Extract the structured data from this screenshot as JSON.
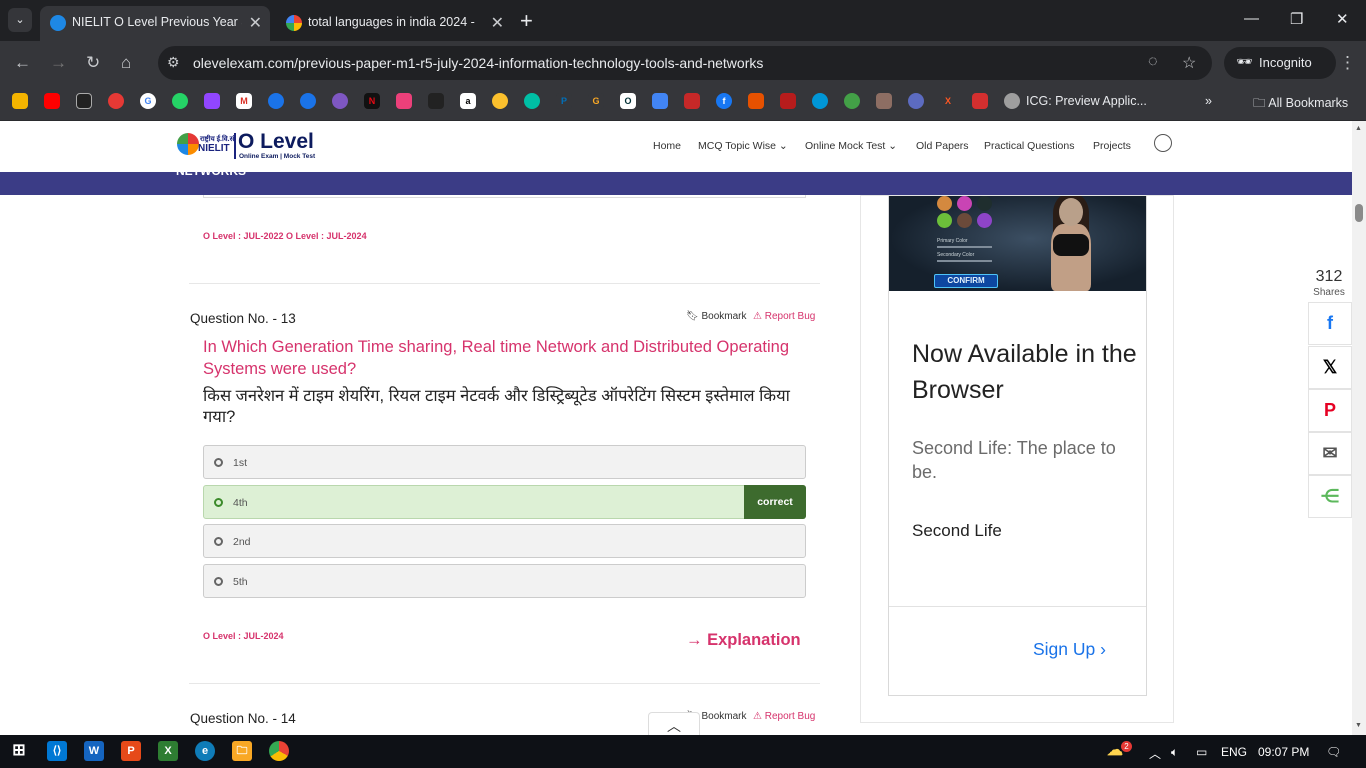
{
  "browser": {
    "tabs": [
      {
        "title": "NIELIT O Level Previous Year So",
        "close": "✕"
      },
      {
        "title": "total languages in india 2024 - ",
        "close": "✕"
      }
    ],
    "new_tab": "+",
    "url": "olevelexam.com/previous-paper-m1-r5-july-2024-information-technology-tools-and-networks",
    "profile_label": "Incognito",
    "bookmark_folder_label": "ICG: Preview Applic...",
    "all_bookmarks": "All Bookmarks",
    "overflow": "»"
  },
  "site": {
    "logo_sub": "राष्ट्रीय ई.वि.सं.",
    "logo_nielit": "NIELIT",
    "logo_title": "O Level",
    "logo_tagline": "Online Exam | Mock Test",
    "nav": [
      {
        "label": "Home"
      },
      {
        "label": "MCQ Topic Wise ⌄"
      },
      {
        "label": "Online Mock Test ⌄"
      },
      {
        "label": "Old Papers"
      },
      {
        "label": "Practical Questions"
      },
      {
        "label": "Projects"
      }
    ],
    "banner_partial": "NETWORKS"
  },
  "prev_question": {
    "tags": "O Level : JUL-2022 O Level : JUL-2024"
  },
  "question13": {
    "number": "Question No. - 13",
    "bookmark": "Bookmark",
    "report": "Report Bug",
    "text_en": "In Which Generation Time sharing, Real time Network and Distributed Operating Systems were used?",
    "text_hi": "किस जनरेशन में टाइम शेयरिंग, रियल टाइम नेटवर्क और डिस्ट्रिब्यूटेड ऑपरेटिंग सिस्टम इस्तेमाल किया गया?",
    "options": [
      {
        "label": "1st"
      },
      {
        "label": "4th",
        "badge": "correct"
      },
      {
        "label": "2nd"
      },
      {
        "label": "5th"
      }
    ],
    "tags": "O Level : JUL-2024",
    "explanation": "→ Explanation"
  },
  "question14": {
    "number": "Question No. - 14",
    "bookmark": "Bookmark",
    "report": "Report Bug"
  },
  "ad": {
    "primary_color": "Primary Color",
    "secondary_color": "Secondary Color",
    "confirm": "CONFIRM",
    "title": "Now Available in the Browser",
    "description": "Second Life: The place to be.",
    "brand": "Second Life",
    "cta": "Sign Up ›"
  },
  "share": {
    "count": "312",
    "label": "Shares",
    "buttons": [
      "facebook-icon",
      "x-icon",
      "pinterest-icon",
      "email-icon",
      "share-icon"
    ]
  },
  "taskbar": {
    "language": "ENG",
    "time": "09:07 PM",
    "weather_badge": "2"
  }
}
